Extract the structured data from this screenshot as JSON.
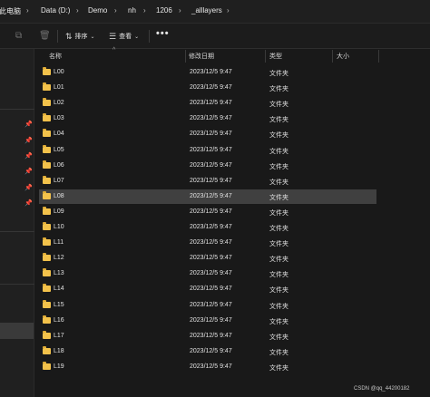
{
  "breadcrumb": {
    "items": [
      "此电脑",
      "Data (D:)",
      "Demo",
      "nh",
      "1206",
      "_alllayers"
    ]
  },
  "toolbar": {
    "sort_label": "排序",
    "view_label": "查看",
    "more_label": "•••"
  },
  "columns": {
    "name": "名称",
    "date": "修改日期",
    "type": "类型",
    "size": "大小"
  },
  "rows": [
    {
      "name": "L00",
      "date": "2023/12/5 9:47",
      "type": "文件夹"
    },
    {
      "name": "L01",
      "date": "2023/12/5 9:47",
      "type": "文件夹"
    },
    {
      "name": "L02",
      "date": "2023/12/5 9:47",
      "type": "文件夹"
    },
    {
      "name": "L03",
      "date": "2023/12/5 9:47",
      "type": "文件夹"
    },
    {
      "name": "L04",
      "date": "2023/12/5 9:47",
      "type": "文件夹"
    },
    {
      "name": "L05",
      "date": "2023/12/5 9:47",
      "type": "文件夹"
    },
    {
      "name": "L06",
      "date": "2023/12/5 9:47",
      "type": "文件夹"
    },
    {
      "name": "L07",
      "date": "2023/12/5 9:47",
      "type": "文件夹"
    },
    {
      "name": "L08",
      "date": "2023/12/5 9:47",
      "type": "文件夹"
    },
    {
      "name": "L09",
      "date": "2023/12/5 9:47",
      "type": "文件夹"
    },
    {
      "name": "L10",
      "date": "2023/12/5 9:47",
      "type": "文件夹"
    },
    {
      "name": "L11",
      "date": "2023/12/5 9:47",
      "type": "文件夹"
    },
    {
      "name": "L12",
      "date": "2023/12/5 9:47",
      "type": "文件夹"
    },
    {
      "name": "L13",
      "date": "2023/12/5 9:47",
      "type": "文件夹"
    },
    {
      "name": "L14",
      "date": "2023/12/5 9:47",
      "type": "文件夹"
    },
    {
      "name": "L15",
      "date": "2023/12/5 9:47",
      "type": "文件夹"
    },
    {
      "name": "L16",
      "date": "2023/12/5 9:47",
      "type": "文件夹"
    },
    {
      "name": "L17",
      "date": "2023/12/5 9:47",
      "type": "文件夹"
    },
    {
      "name": "L18",
      "date": "2023/12/5 9:47",
      "type": "文件夹"
    },
    {
      "name": "L19",
      "date": "2023/12/5 9:47",
      "type": "文件夹"
    }
  ],
  "selected_row": "L08",
  "watermark": "CSDN @qq_44200182",
  "colors": {
    "folder": "#f3c24b",
    "selection": "#404040",
    "background": "#191919"
  }
}
